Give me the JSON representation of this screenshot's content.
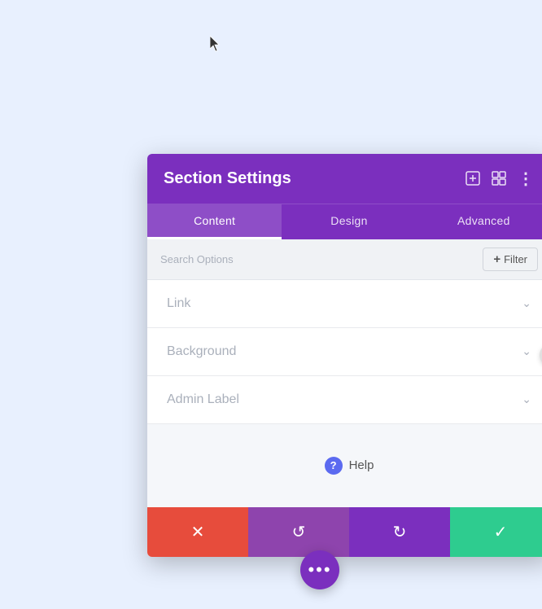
{
  "header": {
    "title": "Section Settings",
    "icons": {
      "expand": "⊞",
      "layout": "▦",
      "more": "⋮"
    }
  },
  "tabs": [
    {
      "label": "Content",
      "active": true
    },
    {
      "label": "Design",
      "active": false
    },
    {
      "label": "Advanced",
      "active": false
    }
  ],
  "search": {
    "placeholder": "Search Options",
    "filter_label": "Filter",
    "filter_prefix": "+"
  },
  "sections": [
    {
      "label": "Link"
    },
    {
      "label": "Background"
    },
    {
      "label": "Admin Label"
    }
  ],
  "help": {
    "icon": "?",
    "label": "Help"
  },
  "footer": {
    "cancel_icon": "✕",
    "reset_icon": "↺",
    "redo_icon": "↻",
    "save_icon": "✓"
  },
  "fab": {
    "label": "•••"
  },
  "colors": {
    "purple_dark": "#7b2fbe",
    "purple_tab": "#8e44ad",
    "red": "#e74c3c",
    "green": "#2ecc8f",
    "side_handle": "#e0e0e0"
  }
}
